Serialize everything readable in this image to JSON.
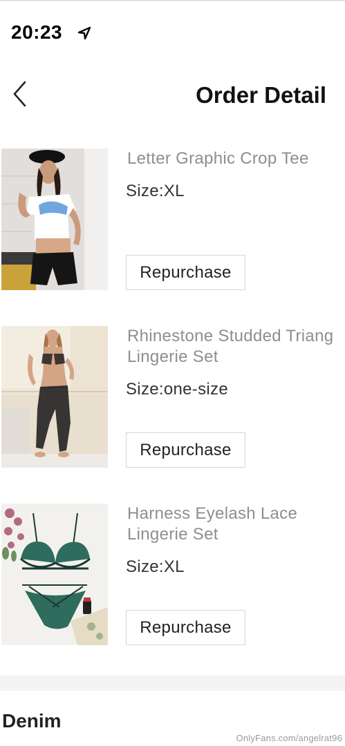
{
  "status_bar": {
    "time": "20:23",
    "location_icon": "location-arrow-icon"
  },
  "nav": {
    "back_icon": "chevron-left-icon",
    "title": "Order Detail"
  },
  "products": [
    {
      "name_lines": [
        "Letter Graphic Crop Tee"
      ],
      "size": "Size:XL",
      "button_label": "Repurchase",
      "image": "crop-tee-photo"
    },
    {
      "name_lines": [
        "Rhinestone Studded Triang",
        "Lingerie Set"
      ],
      "size": "Size:one-size",
      "button_label": "Repurchase",
      "image": "mesh-lingerie-photo"
    },
    {
      "name_lines": [
        "Harness Eyelash Lace",
        "Lingerie Set"
      ],
      "size": "Size:XL",
      "button_label": "Repurchase",
      "image": "green-lace-lingerie-photo"
    }
  ],
  "section": {
    "title": "Denim"
  },
  "watermark": "OnlyFans.com/angelrat96",
  "colors": {
    "background": "#ffffff",
    "product_name": "#8e8e8e",
    "divider": "#f4f4f4",
    "button_border": "#d4d4d4"
  }
}
